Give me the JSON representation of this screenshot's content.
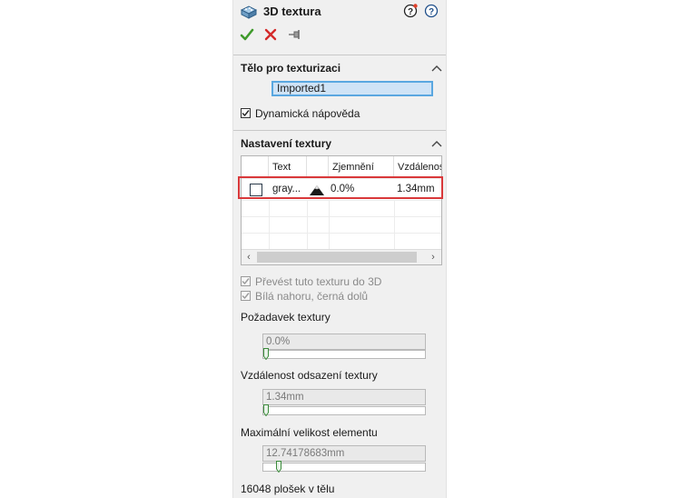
{
  "header": {
    "title": "3D textura",
    "icons": [
      "texture-cube-icon",
      "whats-new-help-icon",
      "help-icon"
    ]
  },
  "actions": [
    "ok-checkmark-icon",
    "cancel-x-icon",
    "pin-icon"
  ],
  "colors": {
    "ok": "#3f9a2b",
    "cancel": "#d42a2a",
    "highlight": "#d9383a",
    "field_border": "#5aa7e0"
  },
  "body_section": {
    "title": "Tělo pro texturizaci",
    "selected_body": "Imported1",
    "dynamic_help_label": "Dynamická nápověda",
    "dynamic_help_checked": true
  },
  "texture_section": {
    "title": "Nastavení textury",
    "columns": [
      "Text",
      "Zjemnění",
      "Vzdálenos"
    ],
    "rows": [
      {
        "checked": false,
        "text": "gray...",
        "icon": "mountain-icon",
        "refinement": "0.0%",
        "distance": "1.34mm"
      }
    ],
    "convert_label": "Převést tuto texturu do 3D",
    "convert_checked": true,
    "white_up_label": "Bílá nahoru, černá dolů",
    "white_up_checked": true
  },
  "texture_request": {
    "label": "Požadavek textury",
    "value": "0.0%",
    "level": 0.0
  },
  "offset_distance": {
    "label": "Vzdálenost odsazení textury",
    "value": "1.34mm",
    "level": 0.0
  },
  "max_element": {
    "label": "Maximální velikost elementu",
    "value": "12.74178683mm",
    "level": 0.08
  },
  "status": {
    "facets_text": "16048 plošek v tělu"
  }
}
